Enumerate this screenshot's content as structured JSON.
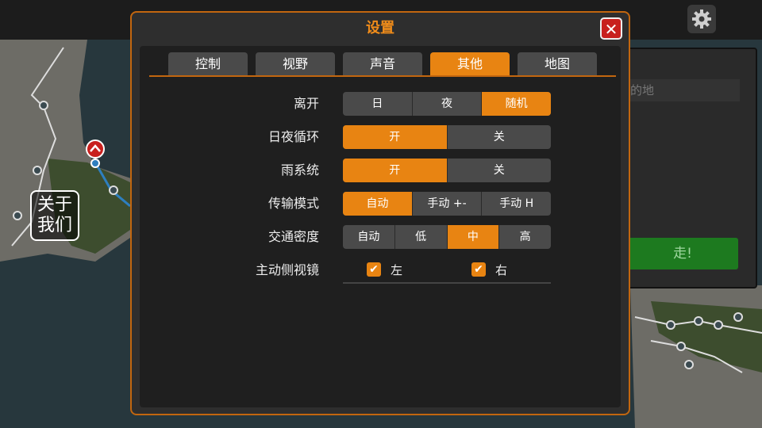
{
  "dialog": {
    "title": "设置",
    "close_icon": "close-icon"
  },
  "tabs": [
    {
      "label": "控制",
      "active": false
    },
    {
      "label": "视野",
      "active": false
    },
    {
      "label": "声音",
      "active": false
    },
    {
      "label": "其他",
      "active": true
    },
    {
      "label": "地图",
      "active": false
    }
  ],
  "settings": {
    "leave": {
      "label": "离开",
      "options": [
        "日",
        "夜",
        "随机"
      ],
      "selected": "随机"
    },
    "daynight": {
      "label": "日夜循环",
      "options": [
        "开",
        "关"
      ],
      "selected": "开"
    },
    "rain": {
      "label": "雨系统",
      "options": [
        "开",
        "关"
      ],
      "selected": "开"
    },
    "transmission": {
      "label": "传输模式",
      "options": [
        "自动",
        "手动 +-",
        "手动 H"
      ],
      "selected": "自动"
    },
    "traffic": {
      "label": "交通密度",
      "options": [
        "自动",
        "低",
        "中",
        "高"
      ],
      "selected": "中"
    },
    "mirrors": {
      "label": "主动侧视镜",
      "left_label": "左",
      "right_label": "右",
      "left_checked": true,
      "right_checked": true
    }
  },
  "background": {
    "about_line1": "关于",
    "about_line2": "我们",
    "field_partial": "的地",
    "go_button": "走!",
    "gear_icon": "gear-icon"
  },
  "colors": {
    "accent": "#e88412",
    "close": "#c8201e",
    "go": "#1d7a1f"
  }
}
